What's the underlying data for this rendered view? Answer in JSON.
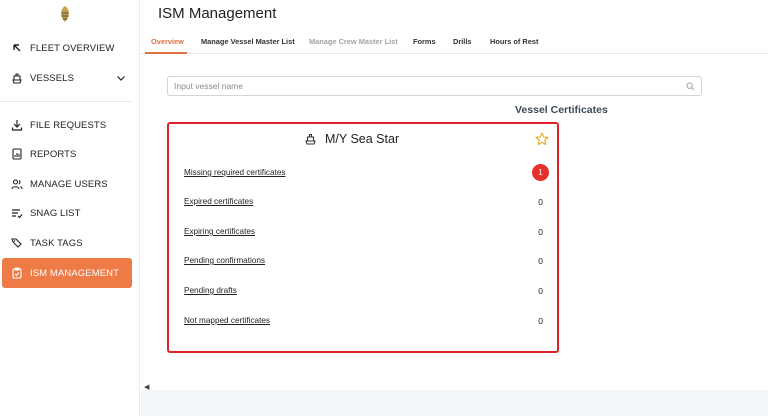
{
  "app": {
    "page_title": "ISM Management"
  },
  "sidebar": {
    "items": [
      {
        "key": "fleet-overview",
        "label": "FLEET OVERVIEW",
        "icon": "arrow-up-left-icon"
      },
      {
        "key": "vessels",
        "label": "VESSELS",
        "icon": "ship-icon",
        "expandable": true
      },
      {
        "key": "file-requests",
        "label": "FILE REQUESTS",
        "icon": "download-icon"
      },
      {
        "key": "reports",
        "label": "REPORTS",
        "icon": "report-icon"
      },
      {
        "key": "manage-users",
        "label": "MANAGE USERS",
        "icon": "users-icon"
      },
      {
        "key": "snag-list",
        "label": "SNAG LIST",
        "icon": "list-check-icon"
      },
      {
        "key": "task-tags",
        "label": "TASK TAGS",
        "icon": "tags-icon"
      },
      {
        "key": "ism-management",
        "label": "ISM MANAGEMENT",
        "icon": "clipboard-check-icon",
        "active": true
      }
    ]
  },
  "tabs": [
    {
      "label": "Overview",
      "state": "active"
    },
    {
      "label": "Manage Vessel Master List",
      "state": "normal"
    },
    {
      "label": "Manage Crew Master List",
      "state": "disabled"
    },
    {
      "label": "Forms",
      "state": "normal"
    },
    {
      "label": "Drills",
      "state": "normal"
    },
    {
      "label": "Hours of Rest",
      "state": "normal"
    }
  ],
  "search": {
    "placeholder": "Input vessel name",
    "value": ""
  },
  "section_heading": "Vessel Certificates",
  "vessel_card": {
    "name": "M/Y Sea Star",
    "favorite": false,
    "rows": [
      {
        "label": "Missing required certificates",
        "count": "1",
        "highlight": true
      },
      {
        "label": "Expired certificates",
        "count": "0"
      },
      {
        "label": "Expiring certificates",
        "count": "0"
      },
      {
        "label": "Pending confirmations",
        "count": "0"
      },
      {
        "label": "Pending drafts",
        "count": "0"
      },
      {
        "label": "Not mapped certificates",
        "count": "0"
      }
    ]
  },
  "colors": {
    "accent": "#ee7a45",
    "card_border": "#e0232a",
    "badge": "#e5322d",
    "star": "#e5a823",
    "heading": "#3b4a5a"
  }
}
